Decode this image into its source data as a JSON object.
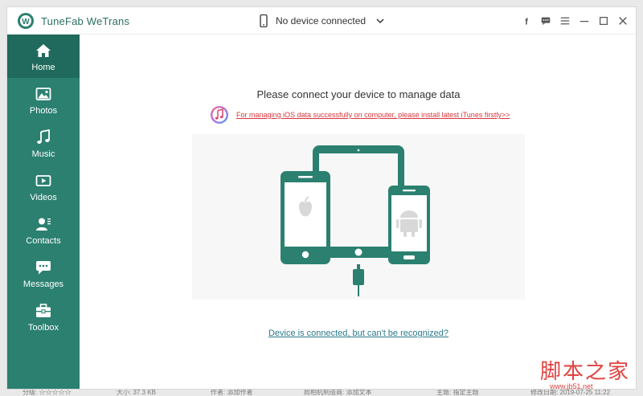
{
  "app": {
    "title": "TuneFab WeTrans"
  },
  "device_selector": {
    "label": "No device connected"
  },
  "sidebar": {
    "items": [
      {
        "label": "Home",
        "icon": "home-icon",
        "active": true
      },
      {
        "label": "Photos",
        "icon": "image-icon",
        "active": false
      },
      {
        "label": "Music",
        "icon": "music-note-icon",
        "active": false
      },
      {
        "label": "Videos",
        "icon": "video-camera-icon",
        "active": false
      },
      {
        "label": "Contacts",
        "icon": "contacts-icon",
        "active": false
      },
      {
        "label": "Messages",
        "icon": "chat-bubble-icon",
        "active": false
      },
      {
        "label": "Toolbox",
        "icon": "toolbox-icon",
        "active": false
      }
    ]
  },
  "main": {
    "headline": "Please connect your device to manage data",
    "itunes_link": "For managing iOS data successfully on computer, please install latest iTunes firstly>>",
    "device_link": "Device is connected, but can't be recognized?"
  },
  "watermark": {
    "text": "脚本之家",
    "url": "www.jb51.net"
  },
  "footer": {
    "items": [
      "分级: ☆☆☆☆☆",
      "大小: 37.3 KB",
      "作者: 添加作者",
      "照相机制造商: 添加文本",
      "主题: 指定主题",
      "修改日期: 2019-07-25 11:22"
    ]
  },
  "colors": {
    "accent": "#2b8070",
    "accent_dark": "#1f6a5c",
    "link_red": "#d9353a",
    "link_blue": "#2b7a8a"
  }
}
